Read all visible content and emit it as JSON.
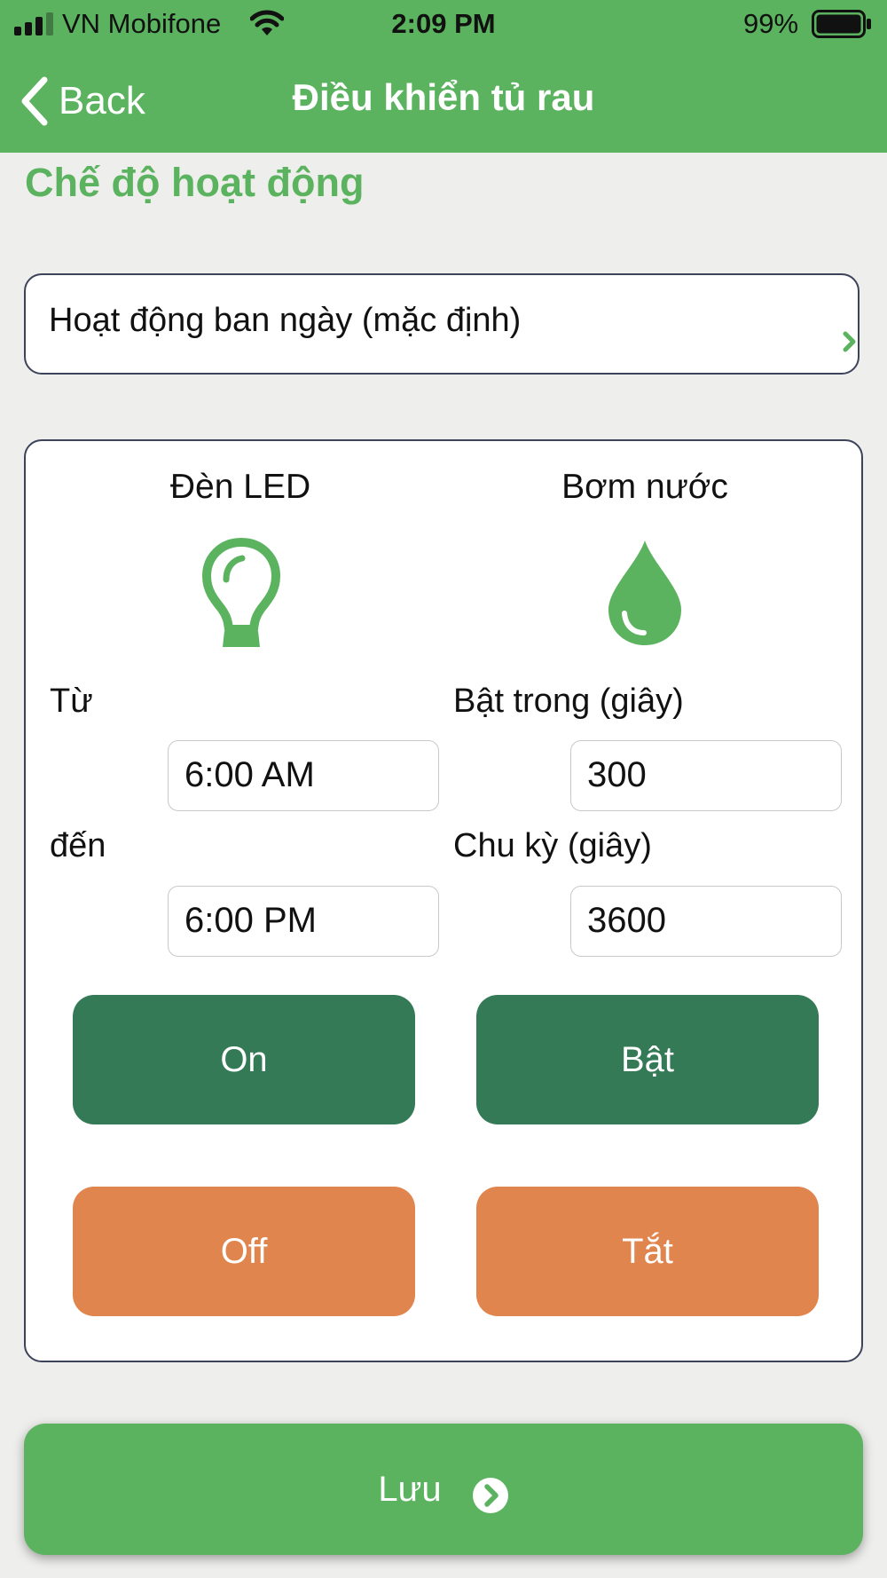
{
  "status_bar": {
    "carrier": "VN Mobifone",
    "time": "2:09 PM",
    "battery": "99%"
  },
  "nav": {
    "back_label": "Back",
    "title": "Điều khiển tủ rau"
  },
  "mode": {
    "section_title": "Chế độ hoạt động",
    "selected": "Hoạt động ban ngày (mặc định)"
  },
  "led": {
    "title": "Đèn LED",
    "icon": "lightbulb-icon",
    "from_label": "Từ",
    "from_value": "6:00 AM",
    "to_label": "đến",
    "to_value": "6:00 PM",
    "on_label": "On",
    "off_label": "Off"
  },
  "pump": {
    "title": "Bơm nước",
    "icon": "water-drop-icon",
    "duration_label": "Bật trong (giây)",
    "duration_value": "300",
    "cycle_label": "Chu kỳ (giây)",
    "cycle_value": "3600",
    "on_label": "Bật",
    "off_label": "Tắt"
  },
  "save": {
    "label": "Lưu",
    "icon": "chevron-circle-right-icon"
  },
  "colors": {
    "header": "#5cb35f",
    "accent": "#5cb35f",
    "on_button": "#347a56",
    "off_button": "#e0854d",
    "background": "#eeeeec"
  }
}
